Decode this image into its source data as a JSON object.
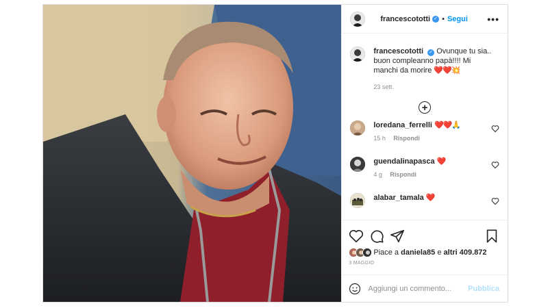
{
  "post": {
    "author": "francescototti",
    "follow_label": "Segui",
    "separator": "•",
    "more_label": "•••",
    "verified_mark": "✓",
    "caption": {
      "text": "Ovunque tu sia.. buon compleanno papà!!!! Mi manchi da morire",
      "emoji": "❤️❤️💥",
      "date": "23 sett."
    },
    "load_more_label": "+",
    "comments": [
      {
        "user": "loredana_ferrelli",
        "text": "",
        "emoji": "❤️❤️🙏",
        "age": "15 h",
        "reply": "Rispondi"
      },
      {
        "user": "guendalinapasca",
        "text": "",
        "emoji": "❤️",
        "age": "4 g",
        "reply": "Rispondi"
      },
      {
        "user": "alabar_tamala",
        "text": "",
        "emoji": "❤️",
        "age": "",
        "reply": ""
      }
    ],
    "likes": {
      "prefix": "Piace a",
      "first_user": "daniela85",
      "middle": "e",
      "others": "altri 409.872"
    },
    "posted_date": "3 MAGGIO",
    "comment_box": {
      "placeholder": "Aggiungi un commento...",
      "publish_label": "Pubblica"
    }
  },
  "icons": [
    "heart-icon",
    "comment-icon",
    "share-icon",
    "bookmark-icon",
    "emoji-icon",
    "plus-circle-icon",
    "more-icon",
    "verified-icon"
  ],
  "colors": {
    "link_blue": "#0095f6",
    "publish_disabled": "#b2dffc",
    "heart_red": "#ed4956",
    "muted": "#8e8e8e",
    "border": "#dbdbdb"
  }
}
